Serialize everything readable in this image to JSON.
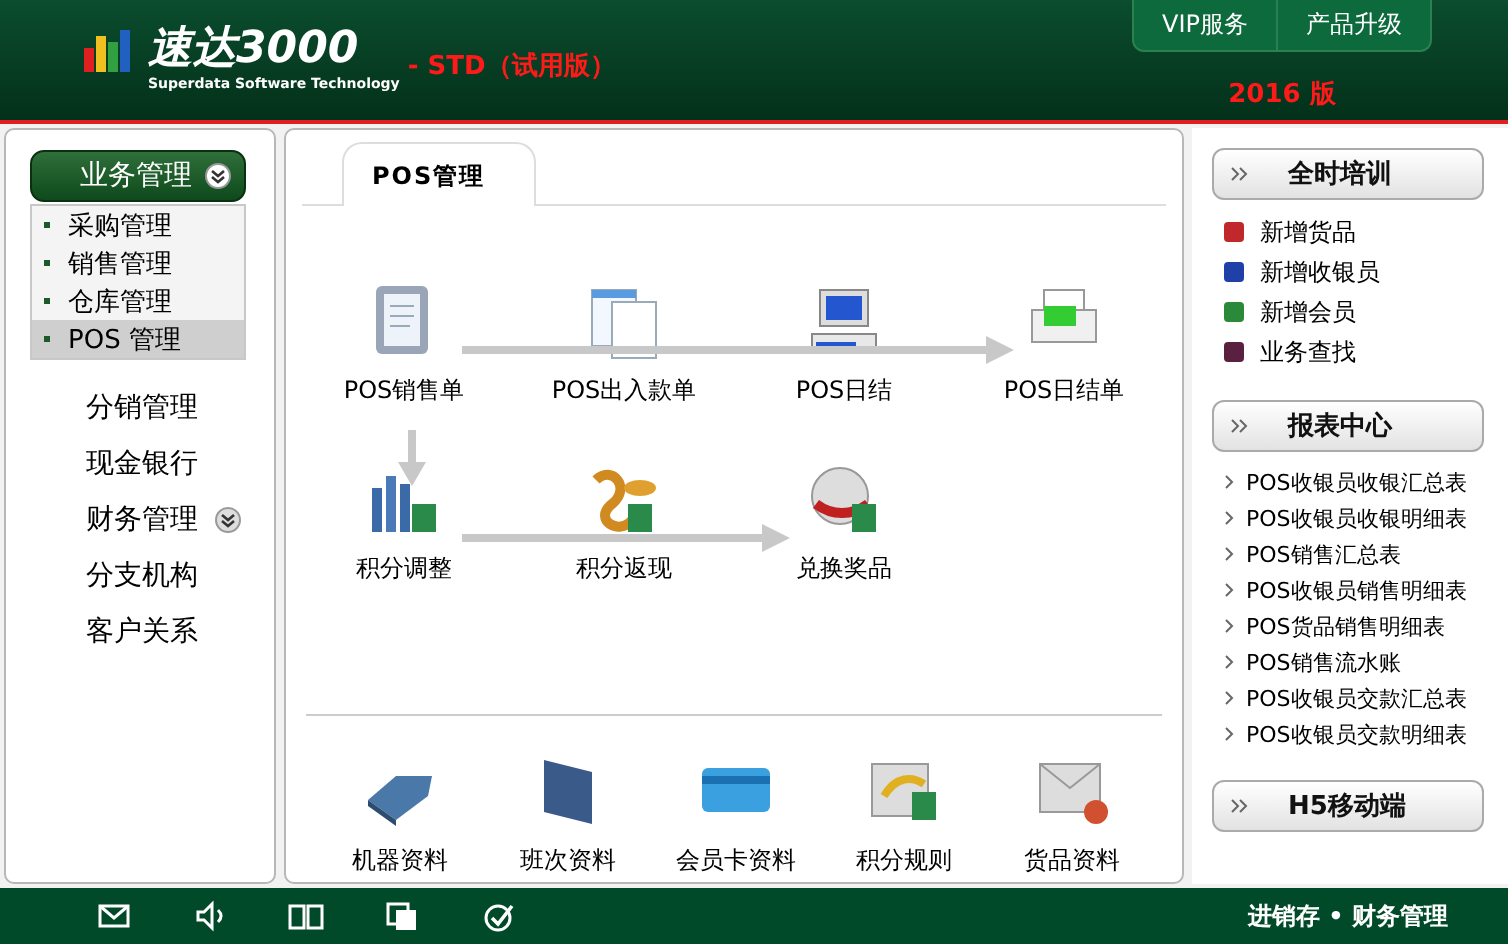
{
  "header": {
    "logo_title": "速达3000",
    "logo_subtitle": "Superdata Software Technology",
    "edition": "- STD（试用版）",
    "top_buttons": [
      "VIP服务",
      "产品升级"
    ],
    "version": "2016 版"
  },
  "sidebar": [
    {
      "kind": "group",
      "label": "业务管理",
      "expanded": true,
      "children": [
        {
          "label": "采购管理",
          "selected": false
        },
        {
          "label": "销售管理",
          "selected": false
        },
        {
          "label": "仓库管理",
          "selected": false
        },
        {
          "label": "POS 管理",
          "selected": true
        }
      ]
    },
    {
      "kind": "link",
      "label": "分销管理"
    },
    {
      "kind": "link",
      "label": "现金银行"
    },
    {
      "kind": "group",
      "label": "财务管理",
      "expanded": false
    },
    {
      "kind": "link",
      "label": "分支机构"
    },
    {
      "kind": "link",
      "label": "客户关系"
    }
  ],
  "main": {
    "tab": "POS管理",
    "flow_rows": [
      [
        {
          "kind": "clipboard",
          "label": "POS销售单"
        },
        {
          "kind": "documents",
          "label": "POS出入款单"
        },
        {
          "kind": "computer",
          "label": "POS日结"
        },
        {
          "kind": "printer",
          "label": "POS日结单"
        }
      ],
      [
        {
          "kind": "chart",
          "label": "积分调整"
        },
        {
          "kind": "coins",
          "label": "积分返现"
        },
        {
          "kind": "exchange",
          "label": "兑换奖品"
        }
      ]
    ],
    "tools": [
      {
        "kind": "device",
        "label": "机器资料"
      },
      {
        "kind": "folder",
        "label": "班次资料"
      },
      {
        "kind": "card",
        "label": "会员卡资料"
      },
      {
        "kind": "rules",
        "label": "积分规则"
      },
      {
        "kind": "mail",
        "label": "货品资料"
      }
    ]
  },
  "right": [
    {
      "title": "全时培训",
      "kind": "training",
      "items": [
        {
          "label": "新增货品",
          "color": "#c0282c"
        },
        {
          "label": "新增收银员",
          "color": "#2040a8"
        },
        {
          "label": "新增会员",
          "color": "#2a8a3a"
        },
        {
          "label": "业务查找",
          "color": "#5a2040"
        }
      ]
    },
    {
      "title": "报表中心",
      "kind": "reports",
      "items": [
        {
          "label": "POS收银员收银汇总表"
        },
        {
          "label": "POS收银员收银明细表"
        },
        {
          "label": "POS销售汇总表"
        },
        {
          "label": "POS收银员销售明细表"
        },
        {
          "label": "POS货品销售明细表"
        },
        {
          "label": "POS销售流水账"
        },
        {
          "label": "POS收银员交款汇总表"
        },
        {
          "label": "POS收银员交款明细表"
        }
      ]
    },
    {
      "title": "H5移动端"
    }
  ],
  "footer": {
    "text": "进销存 • 财务管理"
  }
}
